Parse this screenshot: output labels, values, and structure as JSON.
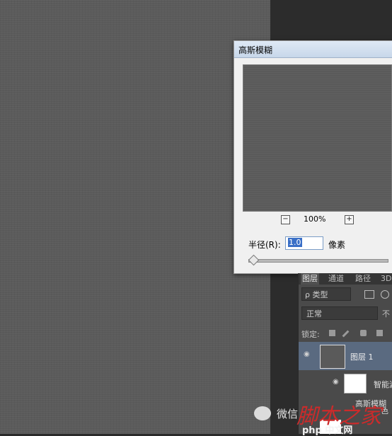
{
  "dialog": {
    "title": "高斯模糊",
    "zoom_out_label": "−",
    "zoom_in_label": "+",
    "zoom_value": "100%",
    "radius_label": "半径(R):",
    "radius_value": "1.0",
    "unit_label": "像素",
    "slider_fraction": 0.01
  },
  "layers_panel": {
    "tabs": [
      "图层",
      "通道",
      "路径",
      "3D"
    ],
    "search_label": "ρ 类型",
    "blend_mode": "正常",
    "opacity_label": "不",
    "lock_label": "锁定:",
    "layer1_name": "图层 1",
    "sublayer_name": "智能滤",
    "fx_label": "高斯模糊",
    "fx_label2": "色"
  },
  "watermark": {
    "prefix": "微信",
    "brand": "脚本之家",
    "sub": "php 中文网"
  }
}
